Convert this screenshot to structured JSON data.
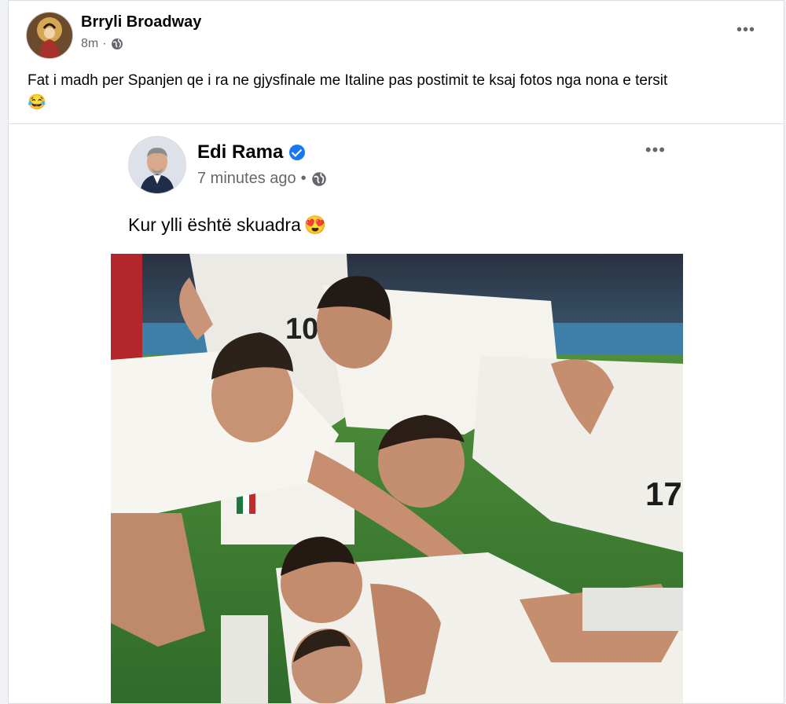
{
  "post": {
    "author": "Brryli Broadway",
    "time": "8m",
    "dot": "·",
    "privacy_icon": "globe-icon",
    "more_icon": "more-options-icon",
    "more_label": "•••",
    "text": "Fat i madh per Spanjen qe i ra ne gjysfinale me Italine pas postimit te ksaj fotos nga nona e tersit",
    "emoji": "😂"
  },
  "shared_post": {
    "author": "Edi Rama",
    "verified_icon": "verified-badge-icon",
    "time": "7 minutes ago",
    "dot": "•",
    "privacy_icon": "globe-icon",
    "more_label": "•••",
    "text": "Kur ylli është skuadra",
    "emoji": "😍"
  },
  "colors": {
    "accent": "#1877f2",
    "muted_text": "#65676b",
    "card_bg": "#ffffff",
    "page_bg": "#f0f2f5"
  }
}
